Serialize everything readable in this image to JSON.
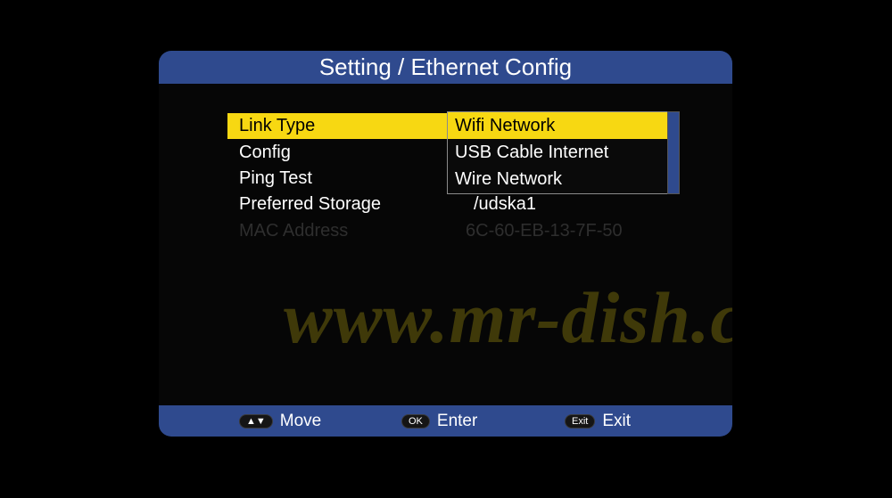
{
  "title": "Setting / Ethernet Config",
  "menu": {
    "items": [
      {
        "label": "Link Type",
        "value": ""
      },
      {
        "label": "Config",
        "value": ""
      },
      {
        "label": "Ping Test",
        "value": ""
      },
      {
        "label": "Preferred Storage",
        "value": "/udska1"
      },
      {
        "label": "MAC Address",
        "value": "6C-60-EB-13-7F-50"
      }
    ]
  },
  "dropdown": {
    "options": [
      "Wifi Network",
      "USB Cable Internet",
      "Wire Network"
    ],
    "selected_index": 0
  },
  "watermark": "www.mr-dish.com",
  "footer": {
    "move_key": "▲▼",
    "move_label": "Move",
    "ok_key": "OK",
    "ok_label": "Enter",
    "exit_key": "Exit",
    "exit_label": "Exit"
  },
  "colors": {
    "accent": "#2f4a8e",
    "highlight": "#f7d812"
  }
}
